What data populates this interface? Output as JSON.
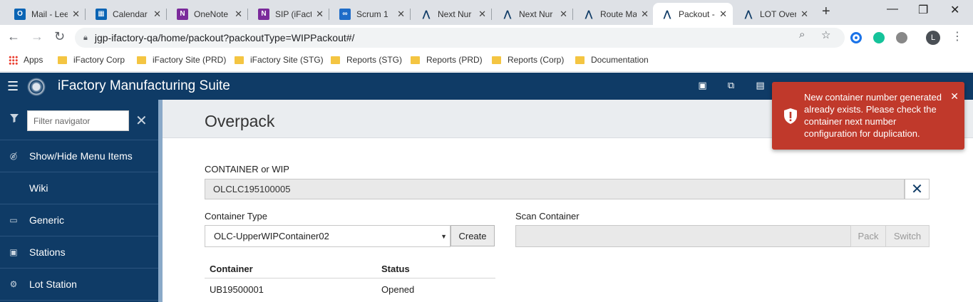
{
  "browser": {
    "tabs": [
      {
        "title": "Mail - Lee",
        "icon_color": "#0a64b4",
        "icon_letter": "O",
        "active": false
      },
      {
        "title": "Calendar",
        "icon_color": "#0a64b4",
        "icon_letter": "",
        "active": false
      },
      {
        "title": "OneNote",
        "icon_color": "#7b2a9b",
        "icon_letter": "N",
        "active": false
      },
      {
        "title": "SIP (iFact",
        "icon_color": "#7b2a9b",
        "icon_letter": "N",
        "active": false
      },
      {
        "title": "Scrum 1",
        "icon_color": "#1e6cc8",
        "icon_letter": "",
        "active": false
      },
      {
        "title": "Next Nur",
        "icon_color": "#0f3b66",
        "icon_letter": "",
        "active": false
      },
      {
        "title": "Next Nur",
        "icon_color": "#0f3b66",
        "icon_letter": "",
        "active": false
      },
      {
        "title": "Route Ma",
        "icon_color": "#0f3b66",
        "icon_letter": "",
        "active": false
      },
      {
        "title": "Packout -",
        "icon_color": "#0f3b66",
        "icon_letter": "",
        "active": true
      },
      {
        "title": "LOT Over",
        "icon_color": "#0f3b66",
        "icon_letter": "",
        "active": false
      }
    ],
    "url": "jgp-ifactory-qa/home/packout?packoutType=WIPPackout#/",
    "avatar_letter": "L",
    "bookmarks": [
      {
        "label": "Apps",
        "type": "apps"
      },
      {
        "label": "iFactory Corp",
        "type": "folder"
      },
      {
        "label": "iFactory Site (PRD)",
        "type": "folder"
      },
      {
        "label": "iFactory Site (STG)",
        "type": "folder"
      },
      {
        "label": "Reports (STG)",
        "type": "folder"
      },
      {
        "label": "Reports (PRD)",
        "type": "folder"
      },
      {
        "label": "Reports (Corp)",
        "type": "folder"
      },
      {
        "label": "Documentation",
        "type": "folder"
      }
    ]
  },
  "header": {
    "title": "iFactory Manufacturing Suite",
    "bg_color": "#0f3b66"
  },
  "sidebar": {
    "filter_placeholder": "Filter navigator",
    "items": [
      {
        "label": "Show/Hide Menu Items",
        "icon": "eye-slash-icon"
      },
      {
        "label": "Wiki",
        "icon": ""
      },
      {
        "label": "Generic",
        "icon": "monitor-icon"
      },
      {
        "label": "Stations",
        "icon": "terminal-icon"
      },
      {
        "label": "Lot Station",
        "icon": "cogs-icon"
      }
    ]
  },
  "main": {
    "page_title": "Overpack",
    "container_or_wip_label": "CONTAINER or WIP",
    "container_or_wip_value": "OLCLC195100005",
    "container_type_label": "Container Type",
    "container_type_selected": "OLC-UpperWIPContainer02",
    "create_label": "Create",
    "scan_container_label": "Scan Container",
    "scan_container_value": "",
    "pack_label": "Pack",
    "switch_label": "Switch",
    "table": {
      "headers": [
        "Container",
        "Status"
      ],
      "rows": [
        [
          "UB19500001",
          "Opened"
        ]
      ]
    }
  },
  "toast": {
    "message": "New container number generated already exists. Please check the container next number configuration for duplication.",
    "bg_color": "#c0392b"
  }
}
